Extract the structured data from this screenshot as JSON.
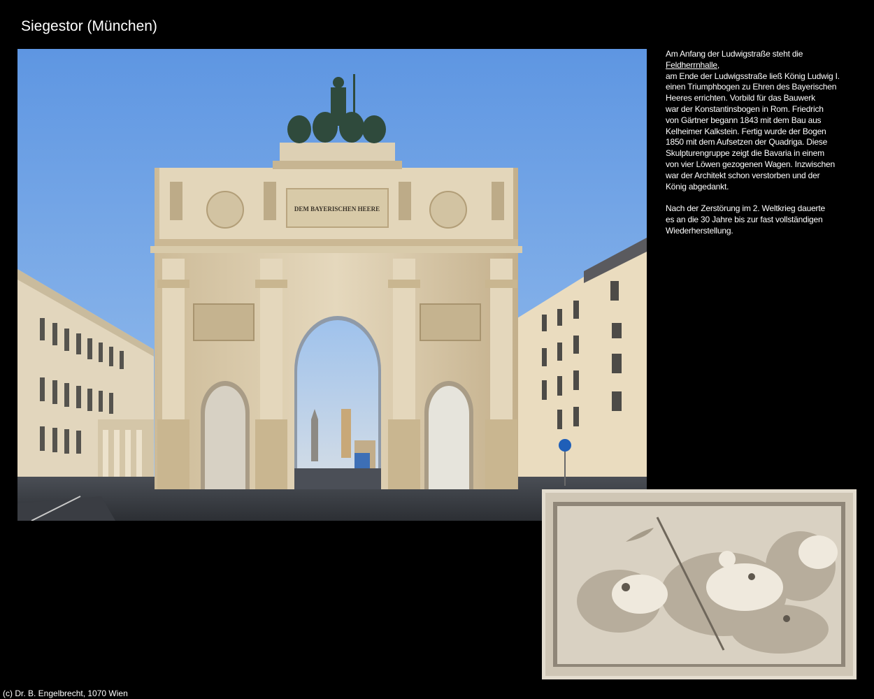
{
  "page": {
    "title": "Siegestor (München)",
    "copyright": "(c) Dr. B. Engelbrecht, 1070 Wien"
  },
  "main_photo": {
    "inscription": "DEM BAYERISCHEN HEERE"
  },
  "description": {
    "line1_prefix": "Am Anfang der Ludwigstraße steht die",
    "link_text": "Feldherrnhalle,",
    "lines_para1": [
      "am Ende der Ludwigsstraße ließ König Ludwig I.",
      "einen Triumphbogen zu Ehren des Bayerischen",
      "Heeres errichten. Vorbild für das Bauwerk",
      "war der Konstantinsbogen in Rom. Friedrich",
      "von Gärtner begann 1843 mit dem Bau aus",
      "Kelheimer Kalkstein. Fertig wurde der Bogen",
      "1850 mit dem Aufsetzen der Quadriga. Diese",
      "Skulpturengruppe zeigt die Bavaria in einem",
      "von vier Löwen gezogenen Wagen. Inzwischen",
      "war der Architekt schon verstorben und der",
      "König abgedankt."
    ],
    "lines_para2": [
      "Nach der Zerstörung im 2. Weltkrieg dauerte",
      "es an die 30 Jahre bis zur fast vollständigen",
      "Wiederherstellung."
    ]
  },
  "colors": {
    "background": "#000000",
    "text": "#ffffff",
    "sky": "#6fa3e6",
    "stone": "#d8cbb2",
    "bronze": "#2f4a3c"
  }
}
